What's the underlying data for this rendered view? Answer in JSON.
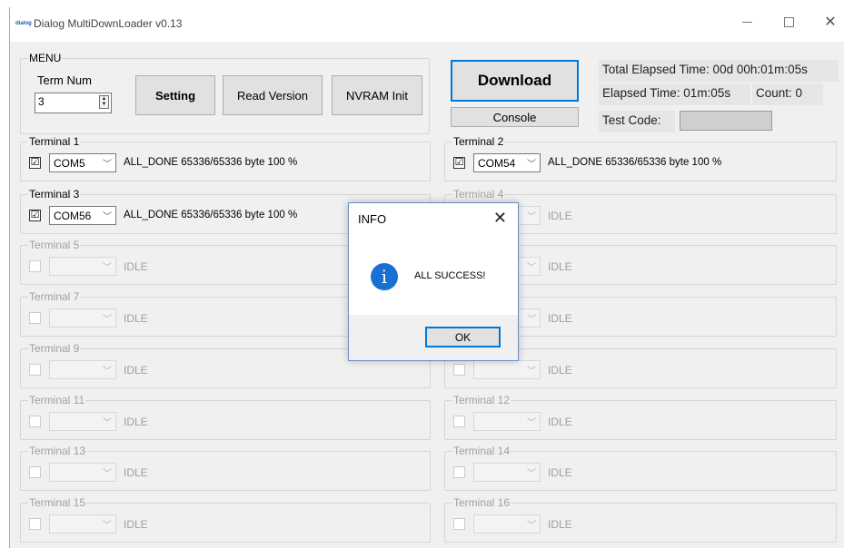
{
  "window": {
    "title": "Dialog MultiDownLoader v0.13",
    "app_icon_text": "dialog"
  },
  "menu": {
    "legend": "MENU",
    "term_num_label": "Term Num",
    "term_num_value": "3",
    "setting_label": "Setting",
    "read_version_label": "Read Version",
    "nvram_init_label": "NVRAM Init"
  },
  "actions": {
    "download_label": "Download",
    "console_label": "Console"
  },
  "status": {
    "total_elapsed": "Total Elapsed Time: 00d 00h:01m:05s",
    "elapsed": "Elapsed Time: 01m:05s",
    "count": "Count: 0",
    "test_code_label": "Test Code:"
  },
  "terminals": [
    {
      "label": "Terminal 1",
      "port": "COM5",
      "checked": "☑",
      "status": "ALL_DONE  65336/65336 byte  100 %"
    },
    {
      "label": "Terminal 2",
      "port": "COM54",
      "checked": "☑",
      "status": "ALL_DONE  65336/65336 byte  100 %"
    },
    {
      "label": "Terminal 3",
      "port": "COM56",
      "checked": "☑",
      "status": "ALL_DONE  65336/65336 byte  100 %"
    },
    {
      "label": "Terminal 4",
      "port": "",
      "checked": "",
      "status": "IDLE"
    },
    {
      "label": "Terminal 5",
      "port": "",
      "checked": "",
      "status": "IDLE"
    },
    {
      "label": "",
      "port": "",
      "checked": "",
      "status": "IDLE"
    },
    {
      "label": "Terminal 7",
      "port": "",
      "checked": "",
      "status": "IDLE"
    },
    {
      "label": "",
      "port": "",
      "checked": "",
      "status": "IDLE"
    },
    {
      "label": "Terminal 9",
      "port": "",
      "checked": "",
      "status": "IDLE"
    },
    {
      "label": "",
      "port": "",
      "checked": "",
      "status": "IDLE"
    },
    {
      "label": "Terminal 11",
      "port": "",
      "checked": "",
      "status": "IDLE"
    },
    {
      "label": "Terminal 12",
      "port": "",
      "checked": "",
      "status": "IDLE"
    },
    {
      "label": "Terminal 13",
      "port": "",
      "checked": "",
      "status": "IDLE"
    },
    {
      "label": "Terminal 14",
      "port": "",
      "checked": "",
      "status": "IDLE"
    },
    {
      "label": "Terminal 15",
      "port": "",
      "checked": "",
      "status": "IDLE"
    },
    {
      "label": "Terminal 16",
      "port": "",
      "checked": "",
      "status": "IDLE"
    }
  ],
  "dialog": {
    "title": "INFO",
    "message": "ALL SUCCESS!",
    "ok_label": "OK",
    "icon": "info-icon"
  },
  "colors": {
    "accent": "#0078d7",
    "info_icon": "#1a6fd2",
    "disabled_text": "#a0a0a0"
  }
}
